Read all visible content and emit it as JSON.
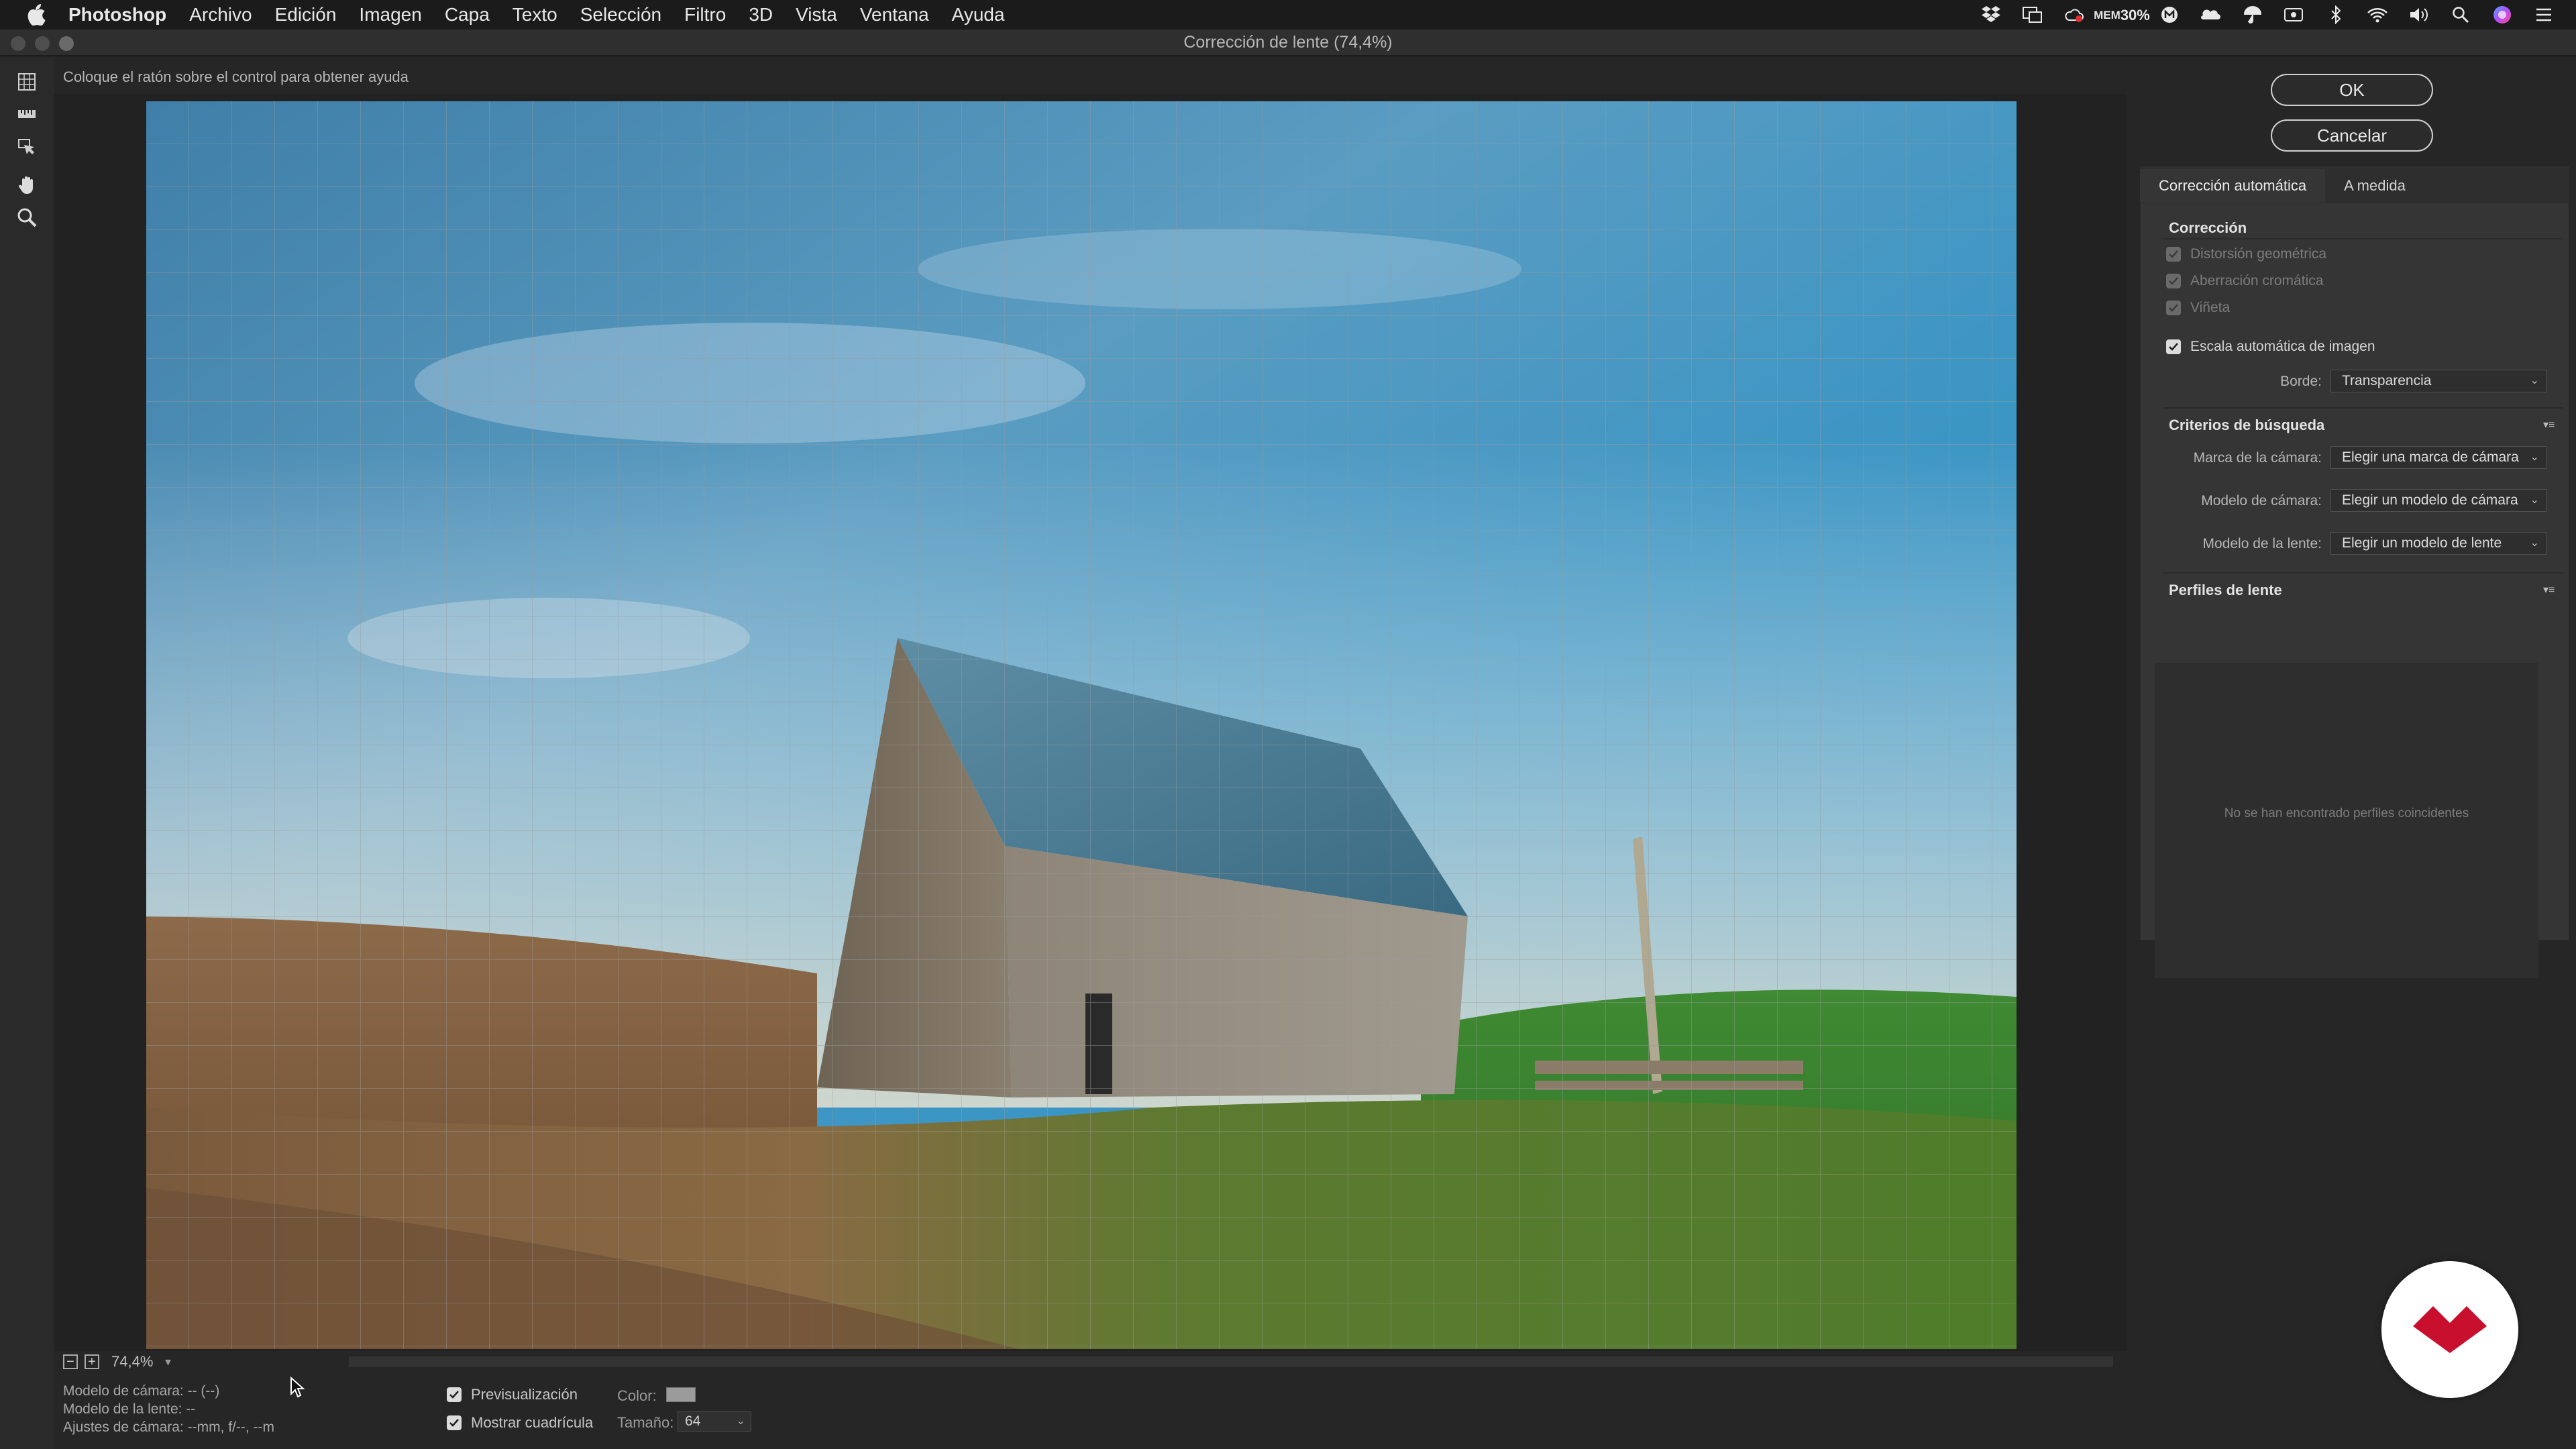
{
  "menubar": {
    "app_name": "Photoshop",
    "items": [
      "Archivo",
      "Edición",
      "Imagen",
      "Capa",
      "Texto",
      "Selección",
      "Filtro",
      "3D",
      "Vista",
      "Ventana",
      "Ayuda"
    ],
    "mem_label": "MEM",
    "mem_value": "30%"
  },
  "window": {
    "title": "Corrección de lente (74,4%)"
  },
  "hint": "Coloque el ratón sobre el control para obtener ayuda",
  "zoom": {
    "value": "74,4%",
    "minus": "−",
    "plus": "+"
  },
  "info": {
    "camera_model": "Modelo de cámara: -- (--)",
    "lens_model": "Modelo de la lente: --",
    "camera_settings": "Ajustes de cámara: --mm, f/--, --m"
  },
  "options": {
    "preview_label": "Previsualización",
    "preview_checked": true,
    "grid_label": "Mostrar cuadrícula",
    "grid_checked": true,
    "color_label": "Color:",
    "grid_color": "#9b9b9b",
    "size_label": "Tamaño:",
    "size_value": "64"
  },
  "buttons": {
    "ok": "OK",
    "cancel": "Cancelar"
  },
  "tabs": [
    {
      "label": "Corrección automática",
      "active": true
    },
    {
      "label": "A medida",
      "active": false
    }
  ],
  "correction": {
    "title": "Corrección",
    "items": [
      {
        "label": "Distorsión geométrica",
        "checked": true,
        "disabled": true
      },
      {
        "label": "Aberración cromática",
        "checked": true,
        "disabled": true
      },
      {
        "label": "Viñeta",
        "checked": true,
        "disabled": true
      }
    ],
    "auto_scale_label": "Escala automática de imagen",
    "auto_scale_checked": true,
    "edge_label": "Borde:",
    "edge_value": "Transparencia"
  },
  "search": {
    "title": "Criterios de búsqueda",
    "make_label": "Marca de la cámara:",
    "make_value": "Elegir una marca de cámara",
    "model_label": "Modelo de cámara:",
    "model_value": "Elegir un modelo de cámara",
    "lens_label": "Modelo de la lente:",
    "lens_value": "Elegir un modelo de lente"
  },
  "profiles": {
    "title": "Perfiles de lente",
    "empty": "No se han encontrado perfiles coincidentes"
  },
  "colors": {
    "accent": "#c8102e"
  }
}
